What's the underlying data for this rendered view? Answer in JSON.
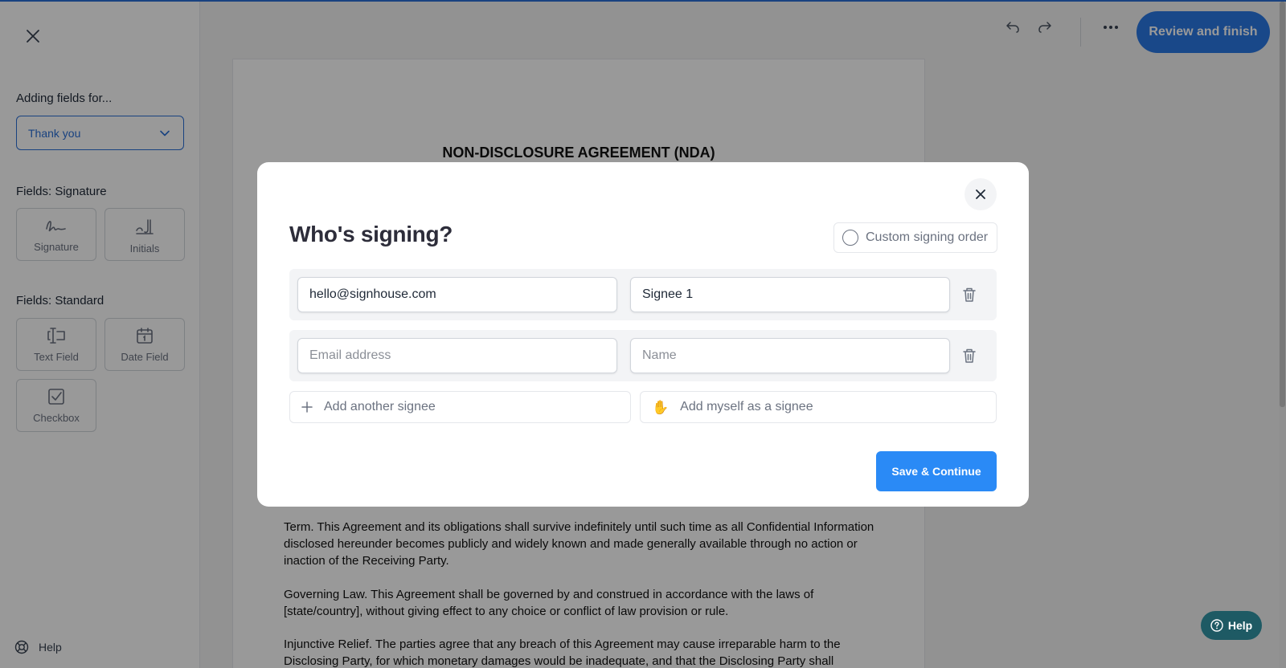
{
  "sidebar": {
    "adding_fields_label": "Adding fields for...",
    "signer_select_value": "Thank you",
    "signature_section_label": "Fields: Signature",
    "signature_fields": [
      {
        "label": "Signature",
        "icon": "signature-icon"
      },
      {
        "label": "Initials",
        "icon": "initials-icon"
      }
    ],
    "standard_section_label": "Fields: Standard",
    "standard_fields": [
      {
        "label": "Text Field",
        "icon": "text-field-icon"
      },
      {
        "label": "Date Field",
        "icon": "calendar-icon"
      },
      {
        "label": "Checkbox",
        "icon": "checkbox-icon"
      }
    ],
    "help_label": "Help"
  },
  "toolbar": {
    "review_button_label": "Review and finish"
  },
  "document": {
    "title": "NON-DISCLOSURE AGREEMENT (NDA)",
    "paragraphs": [
      "Term. This Agreement and its obligations shall survive indefinitely until such time as all Confidential Information disclosed hereunder becomes publicly and widely known and made generally available through no action or inaction of the Receiving Party.",
      "Governing Law. This Agreement shall be governed by and construed in accordance with the laws of [state/country], without giving effect to any choice or conflict of law provision or rule.",
      "Injunctive Relief. The parties agree that any breach of this Agreement may cause irreparable harm to the Disclosing Party, for which monetary damages would be inadequate, and that the Disclosing Party shall"
    ]
  },
  "modal": {
    "title": "Who's signing?",
    "custom_order_label": "Custom signing order",
    "signees": [
      {
        "email_value": "hello@signhouse.com",
        "email_placeholder": "Email address",
        "name_value": "Signee 1",
        "name_placeholder": "Name"
      },
      {
        "email_value": "",
        "email_placeholder": "Email address",
        "name_value": "",
        "name_placeholder": "Name"
      }
    ],
    "add_signee_label": "Add another signee",
    "add_myself_label": "Add myself as a signee",
    "save_button_label": "Save & Continue"
  },
  "help_widget_label": "Help",
  "colors": {
    "accent": "#2a78e4",
    "save_button": "#2a8af6",
    "help_widget": "#1e5a64"
  }
}
